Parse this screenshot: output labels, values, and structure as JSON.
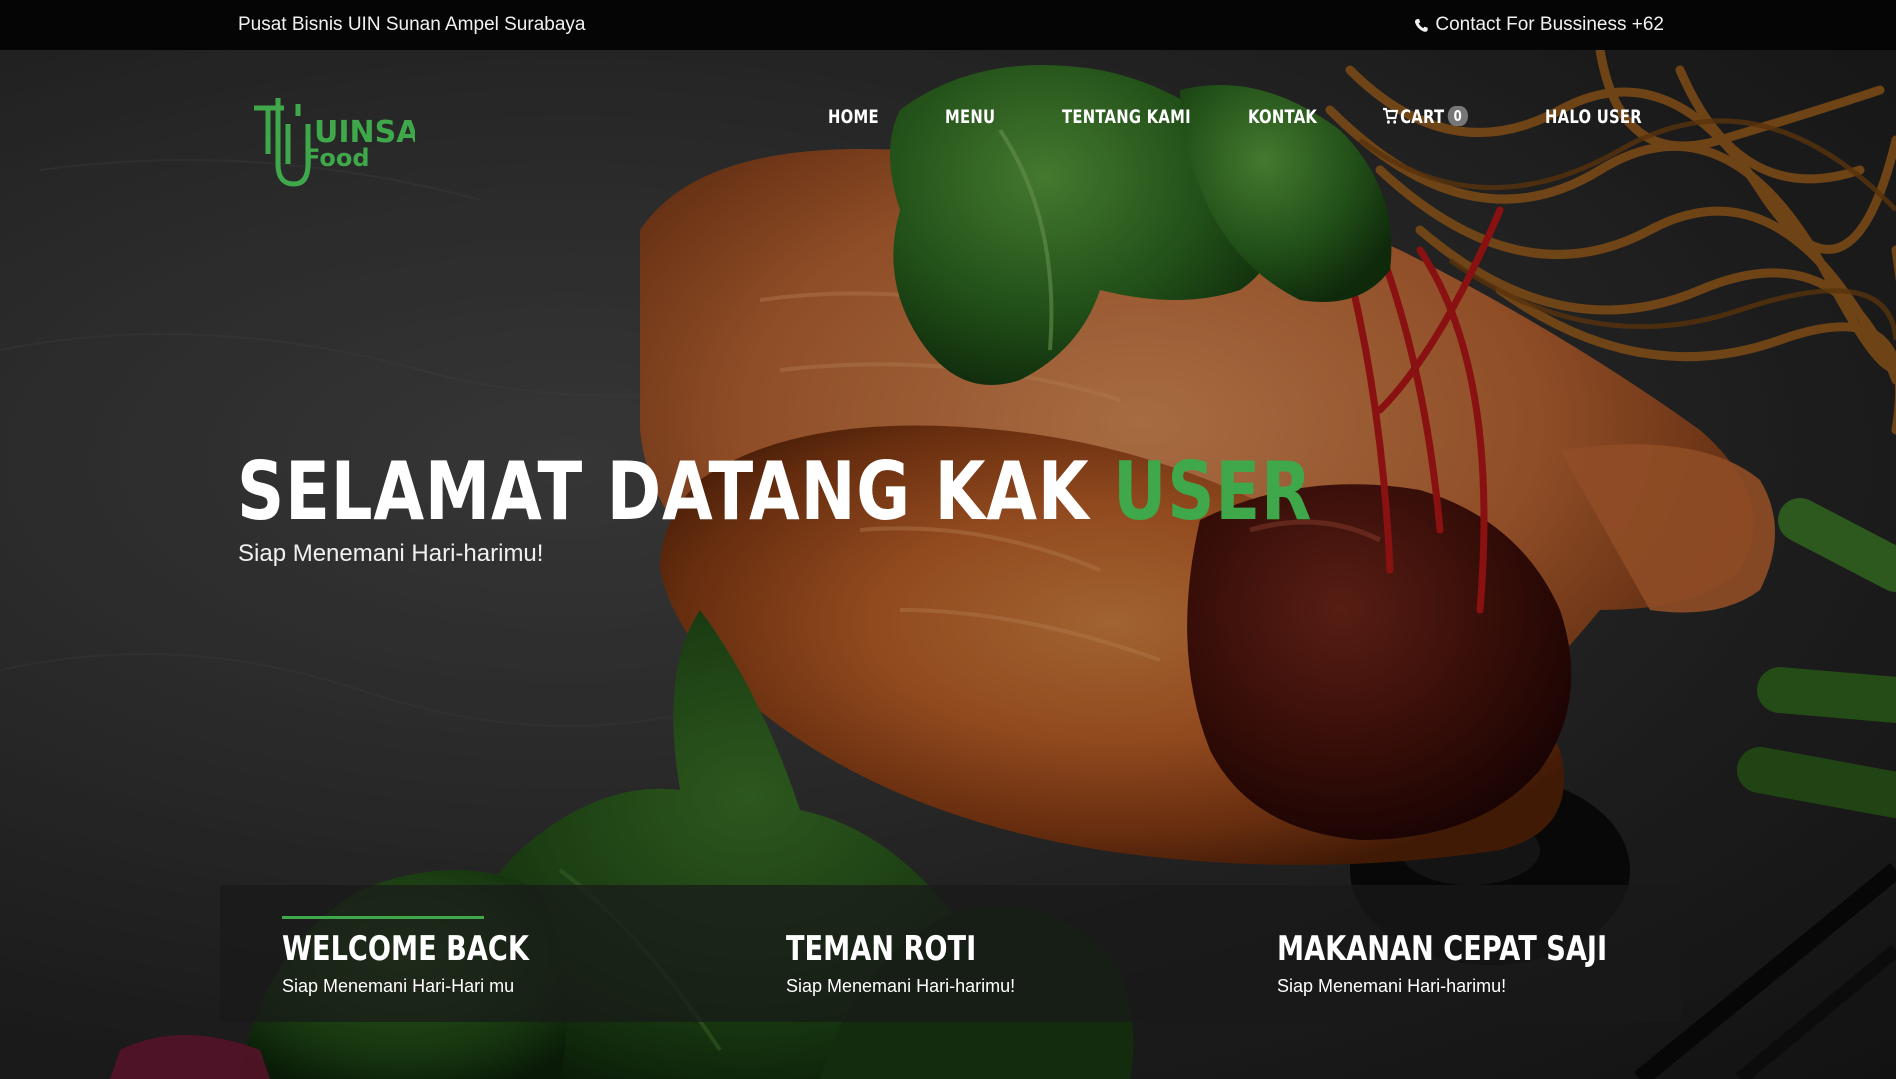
{
  "topbar": {
    "left_text": "Pusat Bisnis UIN Sunan Ampel Surabaya",
    "contact_text": "Contact For Bussiness +62",
    "contact_icon": "phone-icon"
  },
  "brand": {
    "logo_text_top": "UINSA",
    "logo_text_bottom": "Food",
    "logo_color": "#3fa84a"
  },
  "nav": {
    "items": [
      {
        "label": "HOME"
      },
      {
        "label": "MENU"
      },
      {
        "label": "TENTANG KAMI"
      },
      {
        "label": "KONTAK"
      },
      {
        "label": "CART",
        "badge": "0",
        "icon": "cart-icon"
      },
      {
        "label": "HALO USER"
      }
    ]
  },
  "hero": {
    "title_main": "SELAMAT DATANG KAK ",
    "title_accent": "USER",
    "subtitle": "Siap Menemani Hari-harimu!",
    "accent_color": "#3fa84a"
  },
  "features": [
    {
      "title": "WELCOME BACK",
      "desc": "Siap Menemani Hari-Hari mu"
    },
    {
      "title": "TEMAN ROTI",
      "desc": "Siap Menemani Hari-harimu!"
    },
    {
      "title": "MAKANAN CEPAT SAJI",
      "desc": "Siap Menemani Hari-harimu!"
    }
  ]
}
